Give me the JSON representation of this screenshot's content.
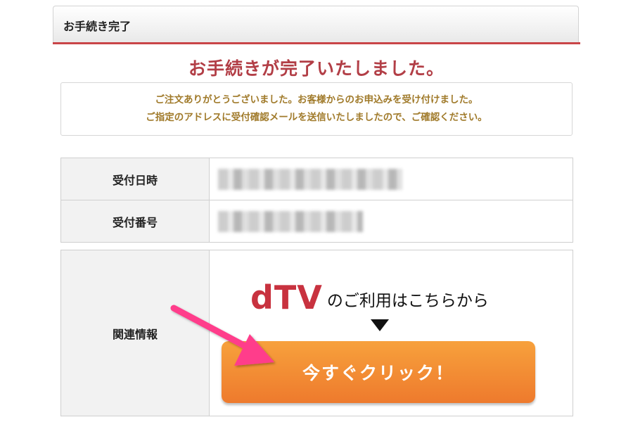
{
  "header": {
    "title": "お手続き完了"
  },
  "complete": {
    "heading": "お手続きが完了いたしました。",
    "message_line1": "ご注文ありがとうございました。お客様からのお申込みを受け付けました。",
    "message_line2": "ご指定のアドレスに受付確認メールを送信いたしましたので、ご確認ください。"
  },
  "details": {
    "rows": [
      {
        "label": "受付日時"
      },
      {
        "label": "受付番号"
      }
    ]
  },
  "related": {
    "label": "関連情報",
    "logo_text": "dTV",
    "logo_suffix": "のご利用はこちらから",
    "button_label": "今すぐクリック！"
  },
  "colors": {
    "accent_red": "#c94548",
    "heading_red": "#b23e46",
    "message_gold": "#a07a2a",
    "button_orange": "#f0852f",
    "arrow_pink": "#ff3d8b"
  },
  "icons": {
    "arrow": "pink-pointer-arrow-icon",
    "down": "down-triangle-icon"
  }
}
